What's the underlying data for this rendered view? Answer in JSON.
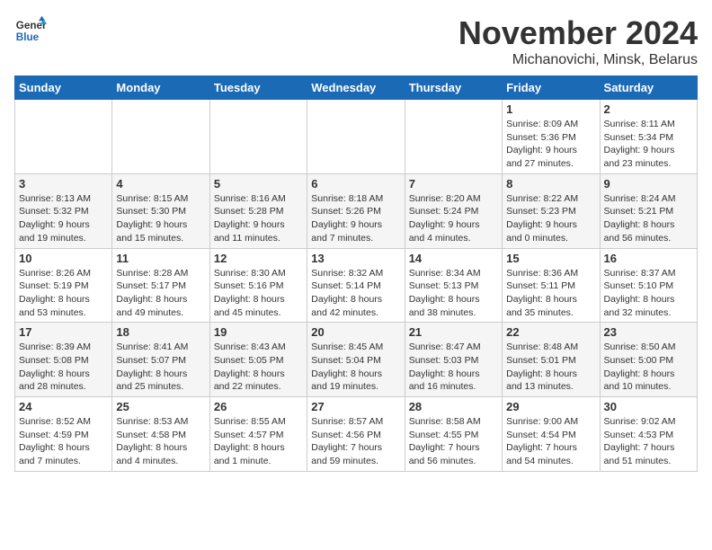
{
  "logo": {
    "line1": "General",
    "line2": "Blue"
  },
  "title": "November 2024",
  "subtitle": "Michanovichi, Minsk, Belarus",
  "days_of_week": [
    "Sunday",
    "Monday",
    "Tuesday",
    "Wednesday",
    "Thursday",
    "Friday",
    "Saturday"
  ],
  "weeks": [
    [
      {
        "day": "",
        "info": ""
      },
      {
        "day": "",
        "info": ""
      },
      {
        "day": "",
        "info": ""
      },
      {
        "day": "",
        "info": ""
      },
      {
        "day": "",
        "info": ""
      },
      {
        "day": "1",
        "info": "Sunrise: 8:09 AM\nSunset: 5:36 PM\nDaylight: 9 hours\nand 27 minutes."
      },
      {
        "day": "2",
        "info": "Sunrise: 8:11 AM\nSunset: 5:34 PM\nDaylight: 9 hours\nand 23 minutes."
      }
    ],
    [
      {
        "day": "3",
        "info": "Sunrise: 8:13 AM\nSunset: 5:32 PM\nDaylight: 9 hours\nand 19 minutes."
      },
      {
        "day": "4",
        "info": "Sunrise: 8:15 AM\nSunset: 5:30 PM\nDaylight: 9 hours\nand 15 minutes."
      },
      {
        "day": "5",
        "info": "Sunrise: 8:16 AM\nSunset: 5:28 PM\nDaylight: 9 hours\nand 11 minutes."
      },
      {
        "day": "6",
        "info": "Sunrise: 8:18 AM\nSunset: 5:26 PM\nDaylight: 9 hours\nand 7 minutes."
      },
      {
        "day": "7",
        "info": "Sunrise: 8:20 AM\nSunset: 5:24 PM\nDaylight: 9 hours\nand 4 minutes."
      },
      {
        "day": "8",
        "info": "Sunrise: 8:22 AM\nSunset: 5:23 PM\nDaylight: 9 hours\nand 0 minutes."
      },
      {
        "day": "9",
        "info": "Sunrise: 8:24 AM\nSunset: 5:21 PM\nDaylight: 8 hours\nand 56 minutes."
      }
    ],
    [
      {
        "day": "10",
        "info": "Sunrise: 8:26 AM\nSunset: 5:19 PM\nDaylight: 8 hours\nand 53 minutes."
      },
      {
        "day": "11",
        "info": "Sunrise: 8:28 AM\nSunset: 5:17 PM\nDaylight: 8 hours\nand 49 minutes."
      },
      {
        "day": "12",
        "info": "Sunrise: 8:30 AM\nSunset: 5:16 PM\nDaylight: 8 hours\nand 45 minutes."
      },
      {
        "day": "13",
        "info": "Sunrise: 8:32 AM\nSunset: 5:14 PM\nDaylight: 8 hours\nand 42 minutes."
      },
      {
        "day": "14",
        "info": "Sunrise: 8:34 AM\nSunset: 5:13 PM\nDaylight: 8 hours\nand 38 minutes."
      },
      {
        "day": "15",
        "info": "Sunrise: 8:36 AM\nSunset: 5:11 PM\nDaylight: 8 hours\nand 35 minutes."
      },
      {
        "day": "16",
        "info": "Sunrise: 8:37 AM\nSunset: 5:10 PM\nDaylight: 8 hours\nand 32 minutes."
      }
    ],
    [
      {
        "day": "17",
        "info": "Sunrise: 8:39 AM\nSunset: 5:08 PM\nDaylight: 8 hours\nand 28 minutes."
      },
      {
        "day": "18",
        "info": "Sunrise: 8:41 AM\nSunset: 5:07 PM\nDaylight: 8 hours\nand 25 minutes."
      },
      {
        "day": "19",
        "info": "Sunrise: 8:43 AM\nSunset: 5:05 PM\nDaylight: 8 hours\nand 22 minutes."
      },
      {
        "day": "20",
        "info": "Sunrise: 8:45 AM\nSunset: 5:04 PM\nDaylight: 8 hours\nand 19 minutes."
      },
      {
        "day": "21",
        "info": "Sunrise: 8:47 AM\nSunset: 5:03 PM\nDaylight: 8 hours\nand 16 minutes."
      },
      {
        "day": "22",
        "info": "Sunrise: 8:48 AM\nSunset: 5:01 PM\nDaylight: 8 hours\nand 13 minutes."
      },
      {
        "day": "23",
        "info": "Sunrise: 8:50 AM\nSunset: 5:00 PM\nDaylight: 8 hours\nand 10 minutes."
      }
    ],
    [
      {
        "day": "24",
        "info": "Sunrise: 8:52 AM\nSunset: 4:59 PM\nDaylight: 8 hours\nand 7 minutes."
      },
      {
        "day": "25",
        "info": "Sunrise: 8:53 AM\nSunset: 4:58 PM\nDaylight: 8 hours\nand 4 minutes."
      },
      {
        "day": "26",
        "info": "Sunrise: 8:55 AM\nSunset: 4:57 PM\nDaylight: 8 hours\nand 1 minute."
      },
      {
        "day": "27",
        "info": "Sunrise: 8:57 AM\nSunset: 4:56 PM\nDaylight: 7 hours\nand 59 minutes."
      },
      {
        "day": "28",
        "info": "Sunrise: 8:58 AM\nSunset: 4:55 PM\nDaylight: 7 hours\nand 56 minutes."
      },
      {
        "day": "29",
        "info": "Sunrise: 9:00 AM\nSunset: 4:54 PM\nDaylight: 7 hours\nand 54 minutes."
      },
      {
        "day": "30",
        "info": "Sunrise: 9:02 AM\nSunset: 4:53 PM\nDaylight: 7 hours\nand 51 minutes."
      }
    ]
  ]
}
